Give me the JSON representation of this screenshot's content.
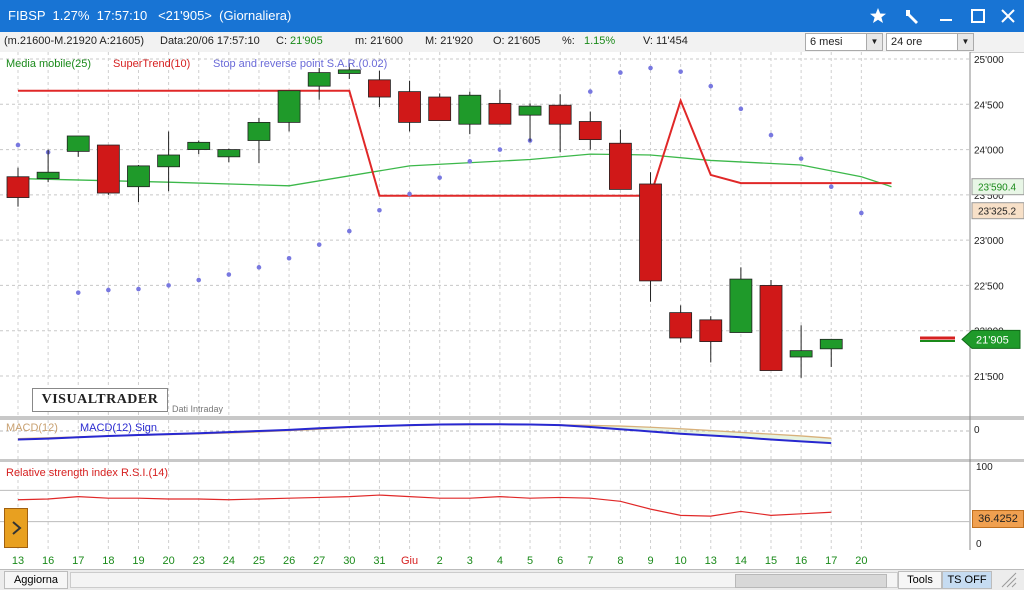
{
  "window": {
    "title": "FIBSP  1.27%  17:57:10   <21'905>  (Giornaliera)",
    "controls": [
      "star-icon",
      "wrench-icon",
      "minimize-icon",
      "maximize-icon",
      "close-icon"
    ]
  },
  "infobar": {
    "range": "(m.21600-M.21920 A:21605)",
    "date": "Data:20/06 17:57:10",
    "close_label": "C:",
    "close_value": "21'905",
    "min": "m: 21'600",
    "max": "M: 21'920",
    "open": "O: 21'605",
    "pct_label": "%:",
    "pct_value": "1.15%",
    "volume": "V: 11'454",
    "period_select": "6 mesi",
    "timeframe_select": "24 ore"
  },
  "legend": {
    "sma": "Media mobile(25)",
    "supertrend": "SuperTrend(10)",
    "sar": "Stop and reverse point S.A.R.(0.02)"
  },
  "watermark": {
    "logo": "VISUALTRADER",
    "sub": "Dati Intraday"
  },
  "price_axis": {
    "labels": [
      "25'000",
      "24'500",
      "24'000",
      "23'500",
      "23'000",
      "22'500",
      "22'000",
      "21'500"
    ],
    "tag_sma": "23'590.4",
    "tag_st": "23'325.2",
    "tag_last": "21'905"
  },
  "macd": {
    "label1": "MACD(12)",
    "label2": "MACD(12) Sign",
    "axis_zero": "0"
  },
  "rsi": {
    "label": "Relative strength index R.S.I.(14)",
    "axis_top": "100",
    "axis_bottom": "0",
    "value_tag": "36.4252"
  },
  "chart_data": {
    "type": "candlestick",
    "x": [
      "13",
      "16",
      "17",
      "18",
      "19",
      "20",
      "23",
      "24",
      "25",
      "26",
      "27",
      "30",
      "31",
      "Giu",
      "2",
      "3",
      "4",
      "5",
      "6",
      "7",
      "8",
      "9",
      "10",
      "13",
      "14",
      "15",
      "16",
      "17",
      "20"
    ],
    "ohlc": [
      [
        23700,
        23800,
        23370,
        23470
      ],
      [
        23680,
        24000,
        23640,
        23750
      ],
      [
        23980,
        24130,
        23920,
        24150
      ],
      [
        24050,
        24050,
        23500,
        23520
      ],
      [
        23590,
        23830,
        23420,
        23820
      ],
      [
        23810,
        24200,
        23540,
        23940
      ],
      [
        24000,
        24100,
        23950,
        24080
      ],
      [
        23920,
        24010,
        23860,
        24000
      ],
      [
        24100,
        24350,
        23850,
        24300
      ],
      [
        24300,
        24650,
        24200,
        24650
      ],
      [
        24700,
        24900,
        24550,
        24850
      ],
      [
        24840,
        24950,
        24780,
        24880
      ],
      [
        24770,
        24870,
        24470,
        24580
      ],
      [
        24640,
        24760,
        24200,
        24300
      ],
      [
        24580,
        24620,
        24320,
        24320
      ],
      [
        24280,
        24640,
        24170,
        24600
      ],
      [
        24510,
        24660,
        24310,
        24280
      ],
      [
        24380,
        24510,
        24090,
        24480
      ],
      [
        24490,
        24610,
        23970,
        24280
      ],
      [
        24310,
        24420,
        24000,
        24110
      ],
      [
        24070,
        24220,
        23780,
        23560
      ],
      [
        23620,
        23750,
        22320,
        22550
      ],
      [
        22200,
        22280,
        21870,
        21920
      ],
      [
        22120,
        22160,
        21650,
        21880
      ],
      [
        21980,
        22700,
        21980,
        22570
      ],
      [
        22500,
        22560,
        21570,
        21560
      ],
      [
        21710,
        22060,
        21480,
        21780
      ],
      [
        21800,
        21910,
        21600,
        21905
      ]
    ],
    "sma25": [
      [
        0,
        23680
      ],
      [
        5,
        23640
      ],
      [
        9,
        23600
      ],
      [
        13,
        23820
      ],
      [
        17,
        23890
      ],
      [
        19,
        23950
      ],
      [
        21,
        23940
      ],
      [
        23,
        23880
      ],
      [
        26,
        23830
      ],
      [
        28,
        23700
      ],
      [
        29,
        23590
      ]
    ],
    "supertrend": [
      [
        0,
        24650
      ],
      [
        11,
        24650
      ],
      [
        12,
        23490
      ],
      [
        21,
        23490
      ],
      [
        22,
        24540
      ],
      [
        23,
        23720
      ],
      [
        24,
        23630
      ],
      [
        29,
        23630
      ]
    ],
    "sar": [
      [
        0,
        24050
      ],
      [
        1,
        23970
      ],
      [
        2,
        22420
      ],
      [
        3,
        22450
      ],
      [
        4,
        22460
      ],
      [
        5,
        22500
      ],
      [
        6,
        22560
      ],
      [
        7,
        22620
      ],
      [
        8,
        22700
      ],
      [
        9,
        22800
      ],
      [
        10,
        22950
      ],
      [
        11,
        23100
      ],
      [
        12,
        23330
      ],
      [
        13,
        23510
      ],
      [
        14,
        23690
      ],
      [
        15,
        23870
      ],
      [
        16,
        24000
      ],
      [
        17,
        24100
      ],
      [
        19,
        24640
      ],
      [
        20,
        24850
      ],
      [
        21,
        24900
      ],
      [
        22,
        24860
      ],
      [
        23,
        24700
      ],
      [
        24,
        24450
      ],
      [
        25,
        24160
      ],
      [
        26,
        23900
      ],
      [
        27,
        23590
      ],
      [
        28,
        23300
      ]
    ],
    "ylim": [
      21350,
      25080
    ],
    "macd_series": [
      -0.95,
      -0.85,
      -0.7,
      -0.55,
      -0.45,
      -0.35,
      -0.25,
      -0.12,
      0.0,
      0.12,
      0.3,
      0.45,
      0.55,
      0.65,
      0.72,
      0.75,
      0.75,
      0.72,
      0.65,
      0.45,
      0.2,
      -0.05,
      -0.3,
      -0.5,
      -0.7,
      -0.95,
      -1.15,
      -1.35
    ],
    "macd_signal": [
      -0.85,
      -0.75,
      -0.65,
      -0.55,
      -0.48,
      -0.4,
      -0.32,
      -0.22,
      -0.1,
      0.05,
      0.2,
      0.4,
      0.55,
      0.6,
      0.68,
      0.7,
      0.72,
      0.7,
      0.68,
      0.62,
      0.55,
      0.42,
      0.25,
      0.05,
      -0.15,
      -0.35,
      -0.55,
      -0.8
    ],
    "rsi_values": [
      58,
      59,
      62,
      60,
      60,
      59,
      59,
      58,
      59,
      60,
      61,
      62,
      64,
      62,
      60,
      60,
      62,
      60,
      61,
      60,
      56,
      46,
      38,
      37,
      43,
      38,
      40,
      42
    ]
  },
  "x_axis": {
    "labels": [
      "13",
      "16",
      "17",
      "18",
      "19",
      "20",
      "23",
      "24",
      "25",
      "26",
      "27",
      "30",
      "31",
      "Giu",
      "2",
      "3",
      "4",
      "5",
      "6",
      "7",
      "8",
      "9",
      "10",
      "13",
      "14",
      "15",
      "16",
      "17",
      "20"
    ]
  },
  "status": {
    "refresh": "Aggiorna",
    "tools": "Tools",
    "ts": "TS OFF"
  }
}
